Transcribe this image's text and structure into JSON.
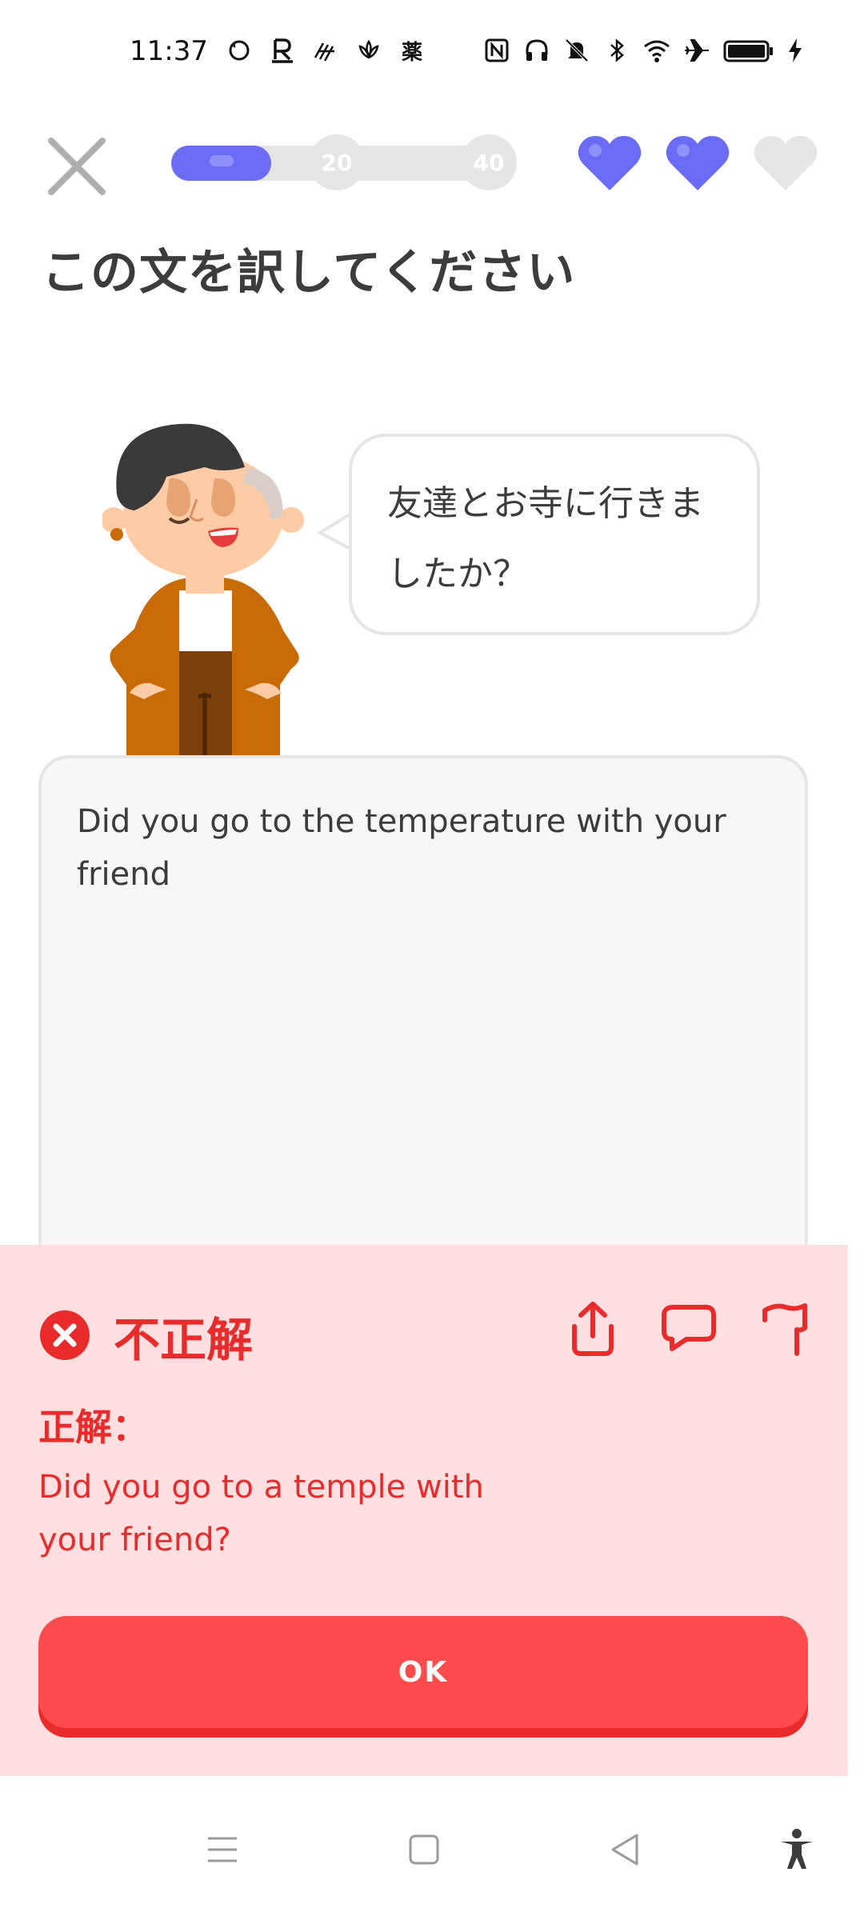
{
  "status_bar": {
    "time": "11:37",
    "left_icons": [
      "sync-icon",
      "rakuten-icon",
      "app-icon",
      "lotus-icon",
      "medicine-icon"
    ],
    "medicine_label": "薬",
    "right_icons": [
      "nfc-icon",
      "headphones-icon",
      "mute-icon",
      "bluetooth-icon",
      "wifi-icon",
      "airplane-icon",
      "battery-icon",
      "charging-icon"
    ]
  },
  "header": {
    "progress": {
      "fraction": 0.29,
      "milestones": [
        "20",
        "40"
      ]
    },
    "hearts": [
      {
        "filled": true
      },
      {
        "filled": true
      },
      {
        "filled": false
      }
    ]
  },
  "title": "この文を訳してください",
  "prompt": {
    "line1": "友達とお寺に行きま",
    "line2": "したか？"
  },
  "answer": {
    "text": "Did you go to the temperature with your friend"
  },
  "feedback": {
    "status": "不正解",
    "correct_label": "正解：",
    "correct_answer": "Did you go to a temple with your friend?",
    "actions": [
      "share-icon",
      "comment-icon",
      "flag-icon"
    ],
    "ok_label": "OK"
  },
  "navbar": {
    "buttons": [
      "menu-icon",
      "home-icon",
      "back-icon",
      "accessibility-icon"
    ]
  },
  "colors": {
    "accent": "#6a6cf6",
    "error": "#ea2b2b",
    "error_bg": "#ffdfe0",
    "button": "#ff4b4b"
  }
}
